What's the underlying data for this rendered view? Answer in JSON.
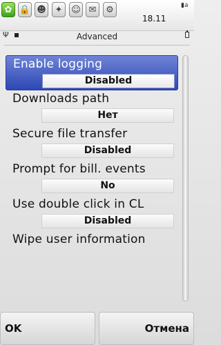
{
  "status_bar": {
    "apps": [
      {
        "name": "ICQ flower",
        "active": true
      },
      {
        "name": "lock"
      },
      {
        "name": "contacts"
      },
      {
        "name": "person"
      },
      {
        "name": "smiley"
      },
      {
        "name": "chat"
      },
      {
        "name": "settings"
      }
    ],
    "time": "18.11"
  },
  "header": {
    "title": "Advanced"
  },
  "settings": [
    {
      "label": "Enable logging",
      "value": "Disabled",
      "selected": true
    },
    {
      "label": "Downloads path",
      "value": "Нет"
    },
    {
      "label": "Secure file transfer",
      "value": "Disabled"
    },
    {
      "label": "Prompt for bill. events",
      "value": "No"
    },
    {
      "label": "Use double click in CL",
      "value": "Disabled"
    },
    {
      "label": "Wipe user information"
    }
  ],
  "softkeys": {
    "left": "OK",
    "right": "Отмена"
  },
  "colors": {
    "selection": "#2d47b5",
    "active_app": "#3fa11b"
  }
}
